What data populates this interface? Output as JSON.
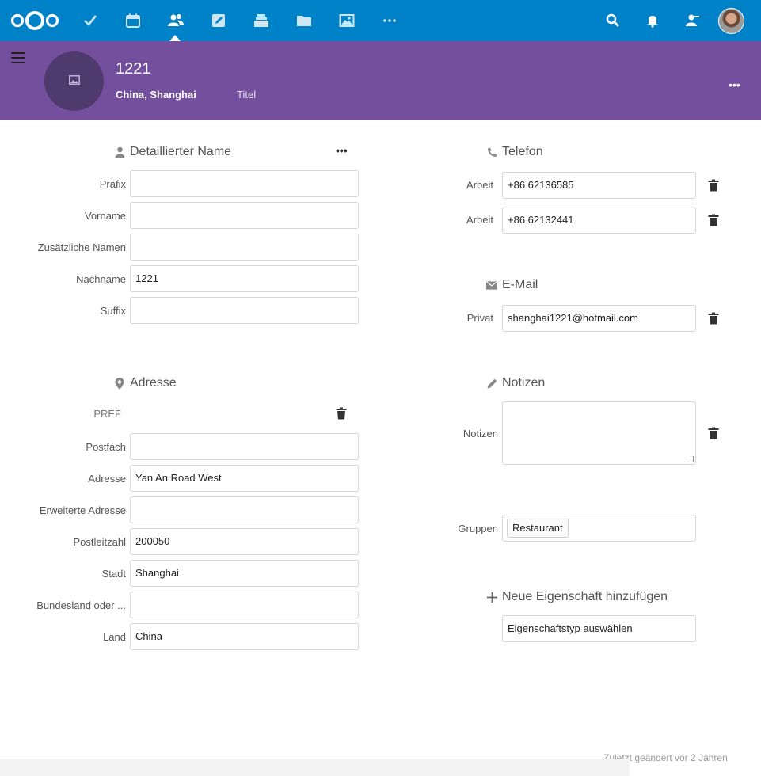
{
  "topbar": {
    "apps": [
      {
        "name": "tasks-icon"
      },
      {
        "name": "calendar-icon"
      },
      {
        "name": "contacts-icon"
      },
      {
        "name": "notes-icon"
      },
      {
        "name": "deck-icon"
      },
      {
        "name": "files-icon"
      },
      {
        "name": "photos-icon"
      },
      {
        "name": "more-apps-icon"
      }
    ],
    "right_icons": [
      "search-icon",
      "notifications-icon",
      "contacts-menu-icon"
    ],
    "accent": "#0082c9"
  },
  "contact": {
    "display_name": "1221",
    "org": "China, Shanghai",
    "title_placeholder": "Titel",
    "header_color": "#734f9e"
  },
  "name_section": {
    "title": "Detaillierter Name",
    "fields": [
      {
        "label": "Präfix",
        "value": ""
      },
      {
        "label": "Vorname",
        "value": ""
      },
      {
        "label": "Zusätzliche Namen",
        "value": ""
      },
      {
        "label": "Nachname",
        "value": "1221"
      },
      {
        "label": "Suffix",
        "value": ""
      }
    ]
  },
  "address_section": {
    "title": "Adresse",
    "type_label": "PREF",
    "fields": [
      {
        "label": "Postfach",
        "value": ""
      },
      {
        "label": "Adresse",
        "value": "Yan An Road West"
      },
      {
        "label": "Erweiterte Adresse",
        "value": ""
      },
      {
        "label": "Postleitzahl",
        "value": "200050"
      },
      {
        "label": "Stadt",
        "value": "Shanghai"
      },
      {
        "label": "Bundesland oder ...",
        "value": ""
      },
      {
        "label": "Land",
        "value": "China"
      }
    ]
  },
  "phone_section": {
    "title": "Telefon",
    "entries": [
      {
        "type": "Arbeit",
        "value": "+86 62136585"
      },
      {
        "type": "Arbeit",
        "value": "+86 62132441"
      }
    ]
  },
  "email_section": {
    "title": "E-Mail",
    "entries": [
      {
        "type": "Privat",
        "value": "shanghai1221@hotmail.com"
      }
    ]
  },
  "notes_section": {
    "title": "Notizen",
    "label": "Notizen",
    "value": ""
  },
  "groups": {
    "label": "Gruppen",
    "tags": [
      "Restaurant"
    ]
  },
  "add_property": {
    "title": "Neue Eigenschaft hinzufügen",
    "select_value": "Eigenschaftstyp auswählen"
  },
  "footer": {
    "last_modified": "Zuletzt geändert vor 2 Jahren"
  }
}
